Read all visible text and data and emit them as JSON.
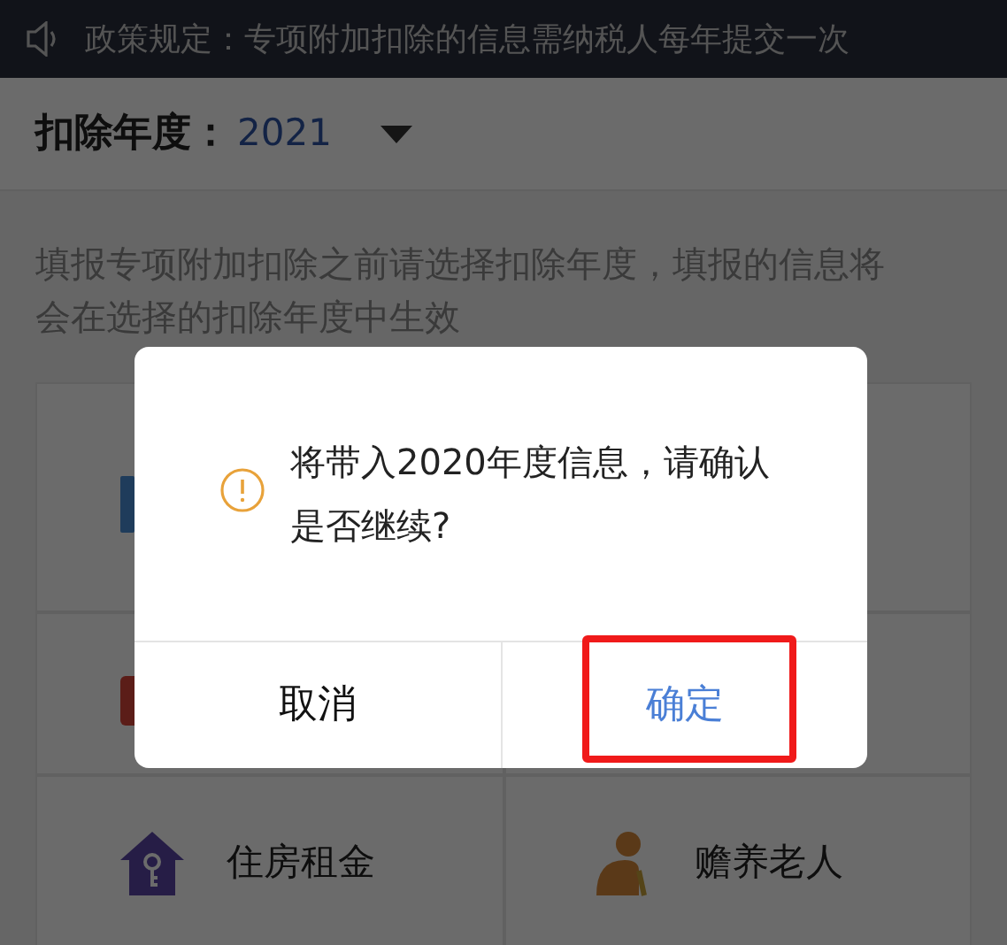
{
  "notice": {
    "text": "政策规定：专项附加扣除的信息需纳税人每年提交一次"
  },
  "year_selector": {
    "label": "扣除年度：",
    "value": "2021"
  },
  "description": "填报专项附加扣除之前请选择扣除年度，填报的信息将会在选择的扣除年度中生效",
  "items": [
    {
      "kind": "books"
    },
    {
      "kind": "blank"
    },
    {
      "kind": "medical"
    },
    {
      "kind": "blank"
    },
    {
      "kind": "house",
      "label": "住房租金"
    },
    {
      "kind": "elder",
      "label": "赡养老人"
    }
  ],
  "dialog": {
    "message": "将带入2020年度信息，请确认是否继续?",
    "buttons": [
      {
        "label": "取消",
        "primary": false,
        "highlighted": false
      },
      {
        "label": "确定",
        "primary": true,
        "highlighted": true
      }
    ]
  }
}
